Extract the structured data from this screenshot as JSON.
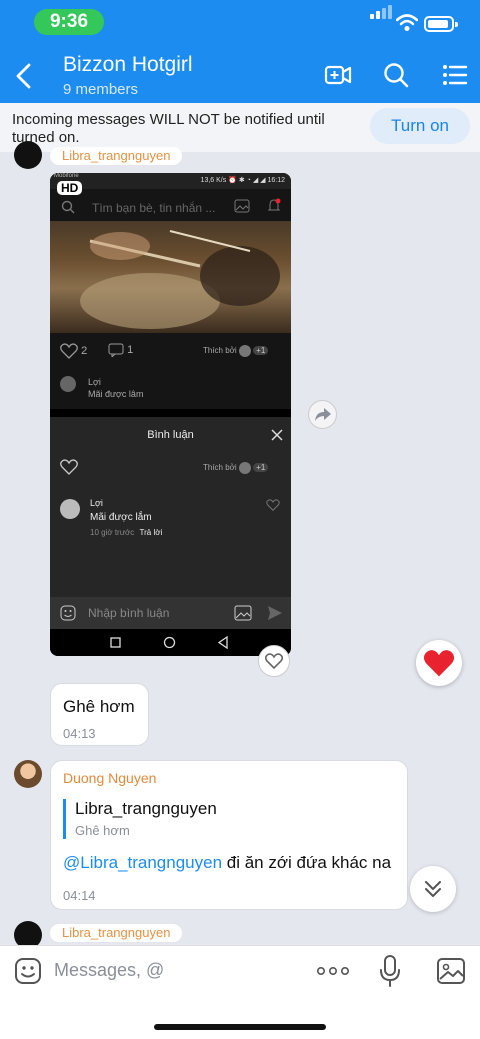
{
  "status_bar": {
    "time": "9:36"
  },
  "header": {
    "title": "Bizzon Hotgirl",
    "subtitle": "9 members"
  },
  "notice": {
    "text": "Incoming messages WILL NOT be notified until turned on.",
    "button": "Turn on"
  },
  "messages": {
    "prev_sender": "Libra_trangnguyen",
    "screenshot": {
      "status_left": "Mobifone",
      "status_right": "13,6 K/s ⏰ ✱ ◔ ◢ ◢ 16:12",
      "hd_badge": "HD",
      "search_placeholder": "Tìm bạn bè, tin nhắn ...",
      "likes": "2",
      "comments": "1",
      "liked_by": "Thích bởi",
      "plus_count": "+1",
      "commenter": "Lợi",
      "comment_text": "Mãi được lâm",
      "sheet_title": "Bình luận",
      "sheet_commenter": "Lợi",
      "sheet_comment": "Mãi được lắm",
      "sheet_time": "10 giờ trước",
      "sheet_reply": "Trả lời",
      "input_placeholder": "Nhập bình luận"
    },
    "msg1": {
      "text": "Ghê hơm",
      "time": "04:13"
    },
    "msg2": {
      "sender": "Duong Nguyen",
      "quote_name": "Libra_trangnguyen",
      "quote_text": "Ghê hơm",
      "mention": "@Libra_trangnguyen",
      "text": " đi ăn zới đứa khác na",
      "time": "04:14"
    },
    "next_sender": "Libra_trangnguyen"
  },
  "composer": {
    "placeholder": "Messages, @"
  },
  "colors": {
    "header": "#1d8cf0",
    "accent": "#1d8cf0",
    "sender_name": "#e08a3c",
    "heart": "#e8232f"
  }
}
